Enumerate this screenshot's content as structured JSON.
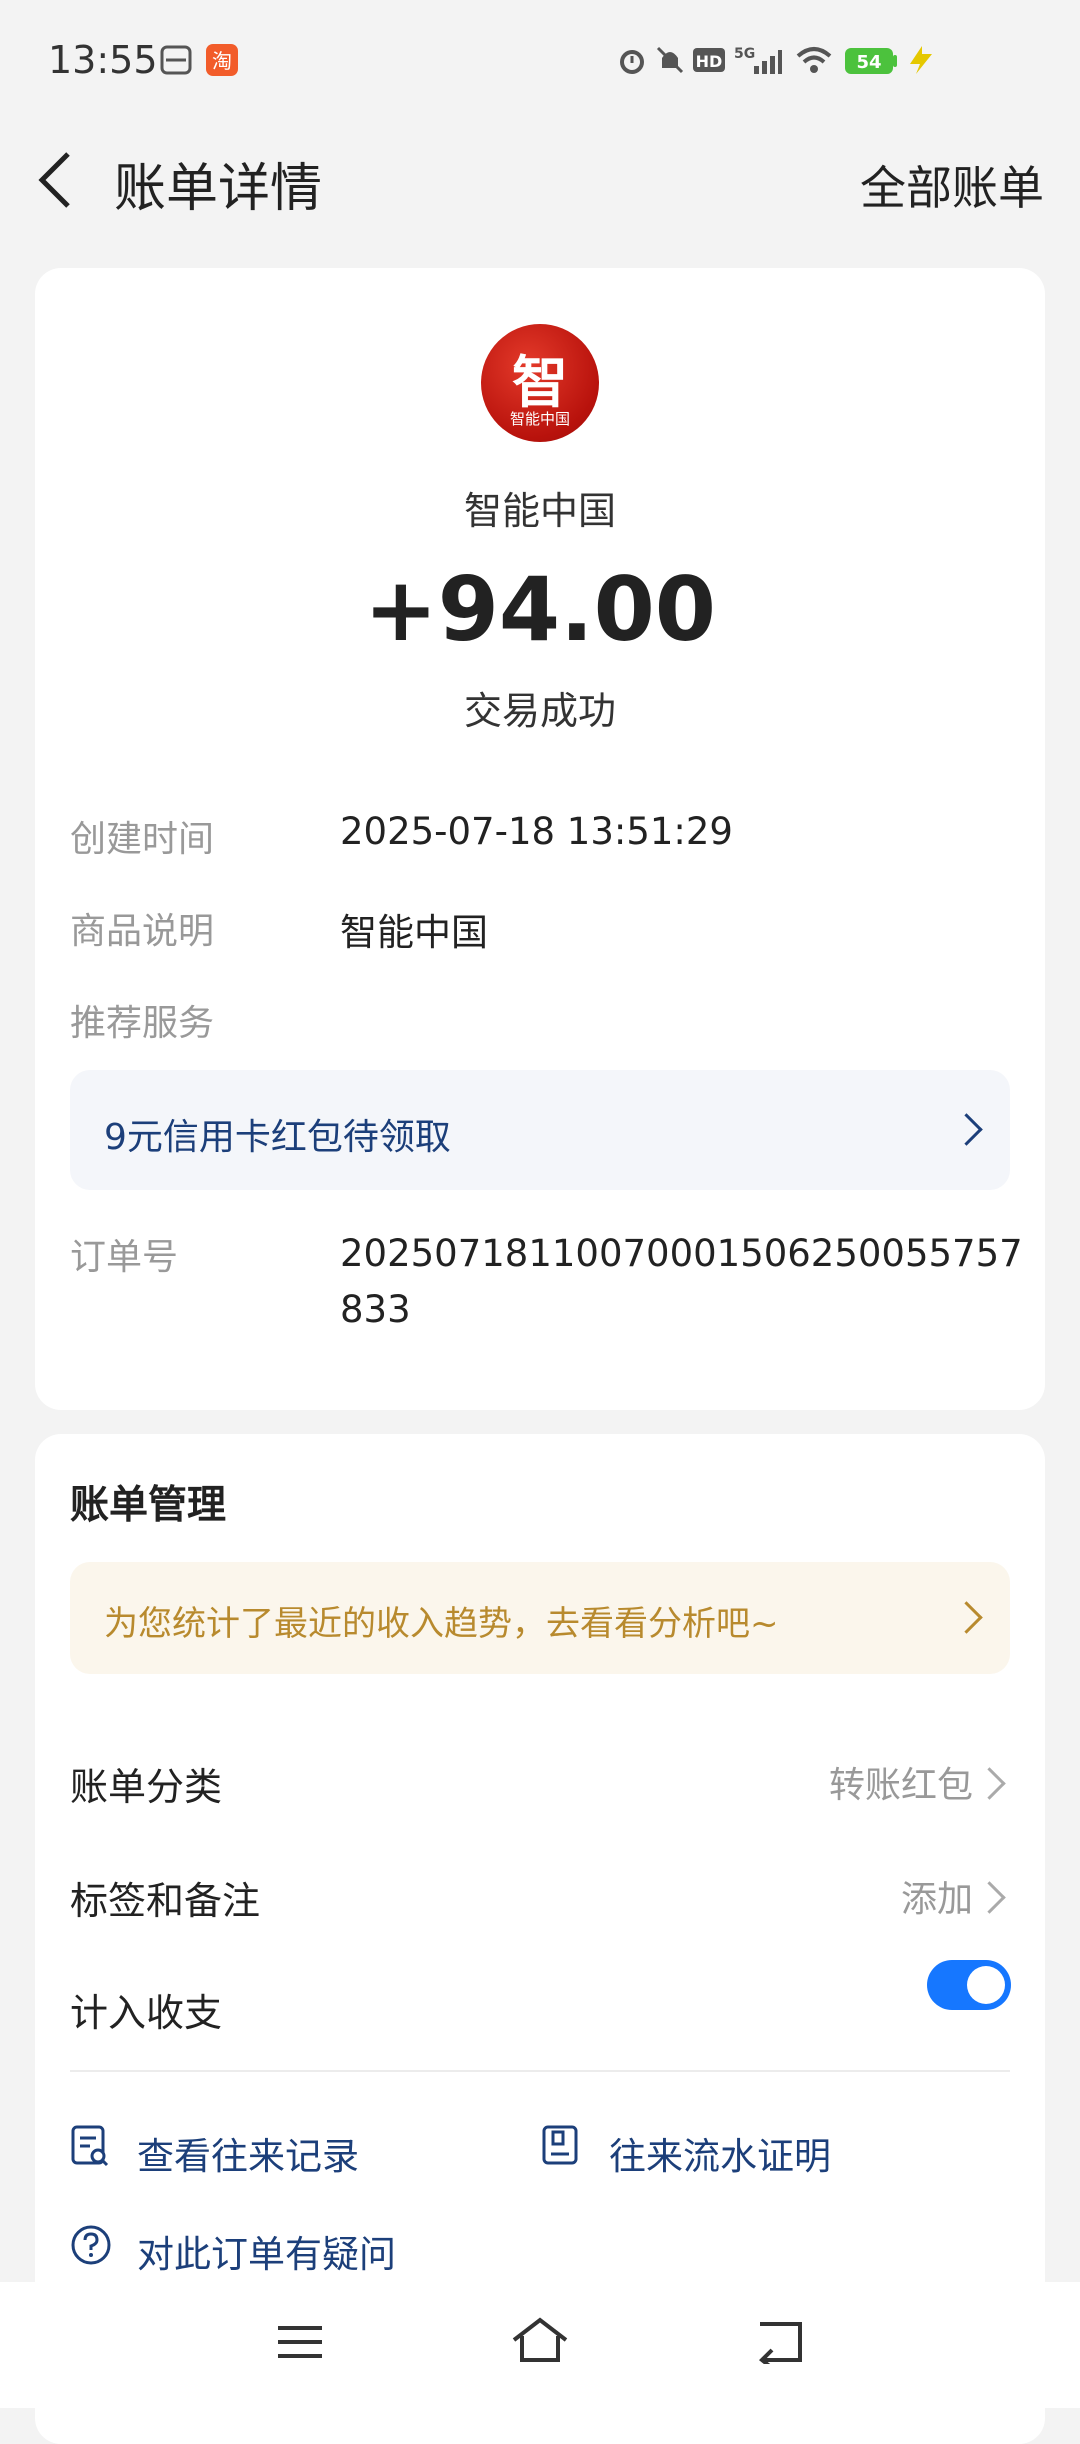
{
  "status_bar": {
    "time": "13:55",
    "network": "5G",
    "battery": "54"
  },
  "header": {
    "title": "账单详情",
    "all_bills": "全部账单"
  },
  "detail": {
    "merchant_logo_text": "智",
    "merchant_logo_sub": "智能中国",
    "merchant": "智能中国",
    "amount": "+94.00",
    "status": "交易成功",
    "rows": [
      {
        "label": "创建时间",
        "value": "2025-07-18 13:51:29"
      },
      {
        "label": "商品说明",
        "value": "智能中国"
      },
      {
        "label": "推荐服务",
        "value": ""
      }
    ],
    "promo": "9元信用卡红包待领取",
    "order_label": "订单号",
    "order_no": "20250718110070001506250055757833"
  },
  "management": {
    "title": "账单管理",
    "tip": "为您统计了最近的收入趋势，去看看分析吧~",
    "category_label": "账单分类",
    "category_value": "转账红包",
    "tag_label": "标签和备注",
    "tag_value": "添加",
    "count_label": "计入收支",
    "count_enabled": true,
    "link_records": "查看往来记录",
    "link_proof": "往来流水证明",
    "link_question": "对此订单有疑问"
  },
  "icons": {
    "back": "back-arrow-icon",
    "menu": "menu-icon",
    "home": "home-icon",
    "return": "return-icon"
  },
  "colors": {
    "accent": "#1677ff",
    "link": "#1c3f7a",
    "tip": "#b88a2e",
    "logo": "#c8170f"
  }
}
